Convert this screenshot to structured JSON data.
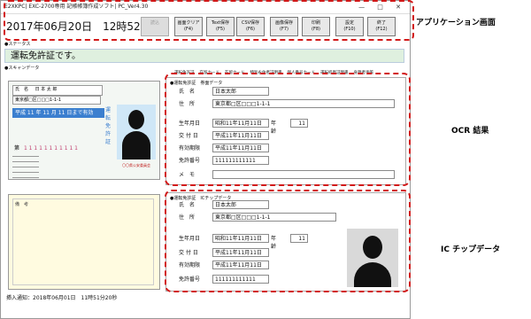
{
  "window": {
    "title": "E2XKPC| EXC-2700専用 記帳帳簿作成ソフト| PC_Ver4.30"
  },
  "datetime": "2017年06月20日　12時52分",
  "toolbar": [
    {
      "label": "読込",
      "key": "",
      "disabled": true
    },
    {
      "label": "画面クリア",
      "key": "(F4)",
      "disabled": false
    },
    {
      "label": "Text保存",
      "key": "(F5)",
      "disabled": false
    },
    {
      "label": "CSV保存",
      "key": "(F6)",
      "disabled": false
    },
    {
      "label": "画像保存",
      "key": "(F7)",
      "disabled": false
    },
    {
      "label": "印刷",
      "key": "(F8)",
      "disabled": false
    },
    {
      "label": "設定",
      "key": "(F10)",
      "disabled": false
    },
    {
      "label": "終了",
      "key": "(F12)",
      "disabled": false
    }
  ],
  "status": {
    "section": "●ステータス",
    "message": "運転免許証です。"
  },
  "scan": {
    "section": "●スキャンデータ",
    "footer": "挿入通知：2018年06月01日　11時51分20秒"
  },
  "tabs": [
    "運転免許証",
    "在留カード",
    "在留カード",
    "特別永住者証明書",
    "個人番号カード",
    "運転経歴証明書",
    "身障者手帳"
  ],
  "ocr": {
    "title": "●運転免許証　券面データ",
    "fields": [
      {
        "label": "氏　名",
        "value": "日本太郎"
      },
      {
        "label": "住　所",
        "value": "東京都□区□□□1-1-1"
      },
      {
        "label": "生年月日",
        "value": "昭和11年11月11日"
      },
      {
        "label": "交 付 日",
        "value": "平成11年11月11日"
      },
      {
        "label": "有効期限",
        "value": "平成11年11月11日"
      },
      {
        "label": "免許番号",
        "value": "111111111111"
      },
      {
        "label": "メ　モ",
        "value": ""
      }
    ],
    "age_label": "年齢",
    "age_value": "11"
  },
  "ic": {
    "title": "●運転免許証　ICチップデータ",
    "fields": [
      {
        "label": "氏　名",
        "value": "日本太郎"
      },
      {
        "label": "住　所",
        "value": "東京都□区□□□1-1-1"
      },
      {
        "label": "生年月日",
        "value": "昭和11年11月11日"
      },
      {
        "label": "交 付 日",
        "value": "平成11年11月11日"
      },
      {
        "label": "有効期限",
        "value": "平成11年11月11日"
      },
      {
        "label": "免許番号",
        "value": "111111111111"
      }
    ],
    "age_label": "年齢",
    "age_value": "11"
  },
  "card_front": {
    "name_label": "氏　名",
    "name": "日 本 太 郎",
    "address": "東京都□区□□□1-1-1",
    "expiry": "平成 11 年 11 月 11 日まで有効",
    "number_prefix": "第",
    "number": "1 1 1 1 1 1 1 1 1 1 1",
    "vertical_text": "運転免許証",
    "stamp": "〇〇県公安委員会"
  },
  "card_back": {
    "label": "備　考"
  },
  "annotations": {
    "app": "アプリケーション画面",
    "ocr": "OCR 結果",
    "ic": "IC チップデータ"
  },
  "colors": {
    "dash": "#d21818",
    "status_bg": "#dff0df",
    "card_band": "#3b7fcf"
  }
}
